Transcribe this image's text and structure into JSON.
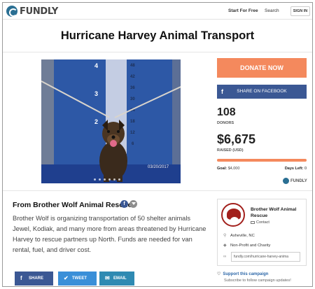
{
  "header": {
    "brand": "FUNDLY",
    "nav_start": "Start For Free",
    "nav_search": "Search",
    "sign_in": "SIGN IN"
  },
  "campaign": {
    "title": "Hurricane Harvey Animal Transport",
    "photo_alt": "dog",
    "photo_numbers_left": [
      "4",
      "3",
      "2"
    ],
    "photo_numbers_right": [
      "48",
      "42",
      "36",
      "30",
      "24",
      "18",
      "12",
      "6"
    ],
    "photo_stamp": "03/20/2017"
  },
  "sidebar": {
    "donate_label": "DONATE NOW",
    "share_fb_label": "SHARE ON FACEBOOK",
    "donors_count": "108",
    "donors_label": "DONORS",
    "raised_amount": "$6,675",
    "raised_label": "RAISED (USD)",
    "progress_fraction": 1.0,
    "goal_label": "Goal:",
    "goal_value": "$4,000",
    "days_label": "Days Left:",
    "days_value": "0",
    "brand": "FUNDLY",
    "accent": "#f4895d",
    "facebook_blue": "#3b5894"
  },
  "description": {
    "from": "From Brother Wolf Animal Rescue",
    "text": "Brother Wolf is organizing transportation of 50 shelter animals Jewel, Kodiak, and many more from areas threatened by Hurricane Harvey to rescue partners up North. Funds are needed for van rental, fuel, and driver cost."
  },
  "share_buttons": {
    "share": "SHARE",
    "tweet": "TWEET",
    "email": "EMAIL"
  },
  "org": {
    "name": "Brother Wolf Animal Rescue",
    "contact": "Contact",
    "location": "Asheville, NC",
    "category": "Non-Profit and Charity",
    "url": "fundly.com/hurricane-harvey-anima"
  },
  "support": {
    "title": "Support this campaign",
    "subtitle": "Subscribe to follow campaign updates!"
  }
}
